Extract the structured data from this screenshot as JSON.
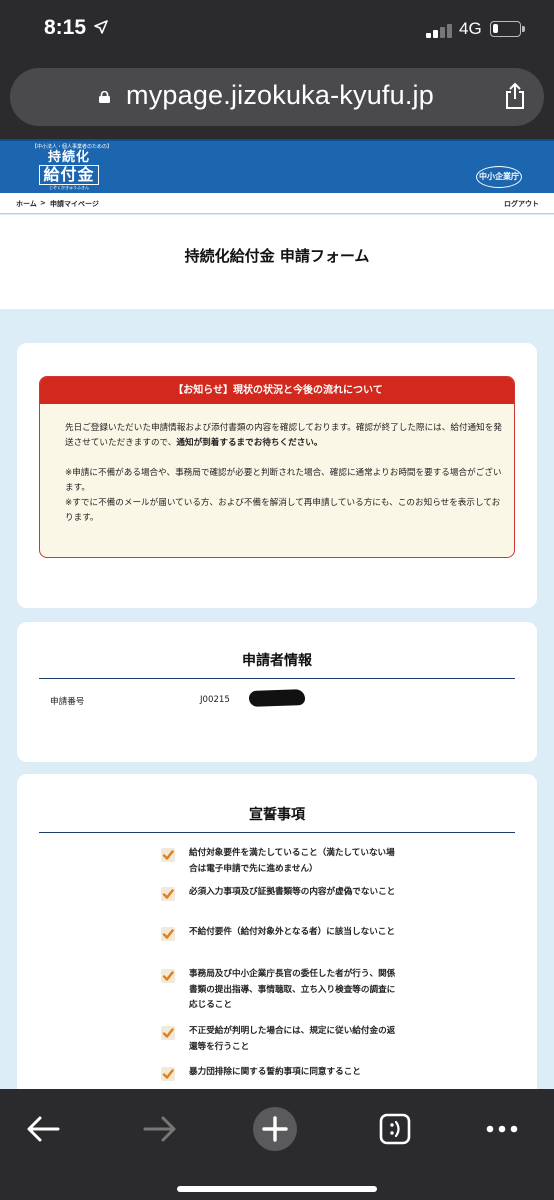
{
  "status_bar": {
    "time": "8:15",
    "network": "4G",
    "battery_level": 0.2,
    "signal_bars": 4
  },
  "browser": {
    "url": "mypage.jizokuka-kyufu.jp"
  },
  "site": {
    "logo_sub": "【中小法人・個人事業者のための】",
    "logo_line1": "持続化",
    "logo_line2": "給付金",
    "logo_ruby": "じぞくかきゅうふきん",
    "agency": "中小企業庁"
  },
  "breadcrumb": {
    "home": "ホーム",
    "separator": ">",
    "current": "申請マイページ",
    "logout": "ログアウト"
  },
  "page_title": "持続化給付金 申請フォーム",
  "notice": {
    "heading": "【お知らせ】現状の状況と今後の流れについて",
    "para1_a": "先日ご登録いただいた申請情報および添付書類の内容を確認しております。確認が終了した際には、給付通知を発送させていただきますので、",
    "para1_b": "通知が到着するまでお待ちください。",
    "para2": "※申請に不備がある場合や、事務局で確認が必要と判断された場合、確認に通常よりお時間を要する場合がございます。",
    "para3": "※すでに不備のメールが届いている方、および不備を解消して再申請している方にも、このお知らせを表示しております。"
  },
  "applicant": {
    "title": "申請者情報",
    "number_label": "申請番号",
    "number_value": "J00215"
  },
  "oath": {
    "title": "宣誓事項",
    "items": [
      "給付対象要件を満たしていること（満たしていない場合は電子申請で先に進めません）",
      "必須入力事項及び証拠書類等の内容が虚偽でないこと",
      "不給付要件（給付対象外となる者）に該当しないこと",
      "事務局及び中小企業庁長官の委任した者が行う、関係書類の提出指導、事情聴取、立ち入り検査等の調査に応じること",
      "不正受給が判明した場合には、規定に従い給付金の返還等を行うこと",
      "暴力団排除に関する誓約事項に同意すること"
    ]
  },
  "colors": {
    "header_blue": "#1c66b0",
    "notice_red": "#d2281d",
    "page_bg": "#dcedf7",
    "check_orange": "#e37d1e"
  },
  "icons": [
    "location-arrow-icon",
    "lock-icon",
    "share-icon",
    "back-icon",
    "forward-icon",
    "new-tab-icon",
    "tabs-icon",
    "more-icon"
  ]
}
